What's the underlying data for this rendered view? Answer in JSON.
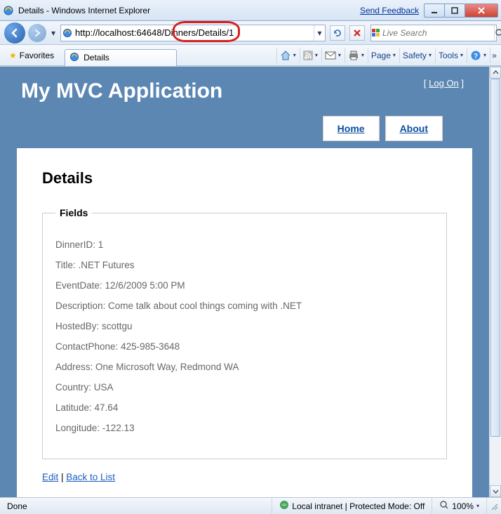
{
  "window": {
    "title": "Details - Windows Internet Explorer",
    "feedback_link": "Send Feedback"
  },
  "nav": {
    "url": "http://localhost:64648/Dinners/Details/1",
    "search_placeholder": "Live Search"
  },
  "cmdbar": {
    "favorites": "Favorites",
    "tab_title": "Details",
    "page_menu": "Page",
    "safety_menu": "Safety",
    "tools_menu": "Tools"
  },
  "app": {
    "title": "My MVC Application",
    "logon_label": "Log On",
    "nav_home": "Home",
    "nav_about": "About",
    "page_heading": "Details",
    "fieldset_legend": "Fields",
    "fields": {
      "dinner_id": "DinnerID: 1",
      "title": "Title: .NET Futures",
      "event_date": "EventDate: 12/6/2009 5:00 PM",
      "description": "Description: Come talk about cool things coming with .NET",
      "hosted_by": "HostedBy: scottgu",
      "contact_phone": "ContactPhone: 425-985-3648",
      "address": "Address: One Microsoft Way, Redmond WA",
      "country": "Country: USA",
      "latitude": "Latitude: 47.64",
      "longitude": "Longitude: -122.13"
    },
    "link_edit": "Edit",
    "link_back": "Back to List"
  },
  "status": {
    "done": "Done",
    "zone": "Local intranet | Protected Mode: Off",
    "zoom": "100%"
  }
}
